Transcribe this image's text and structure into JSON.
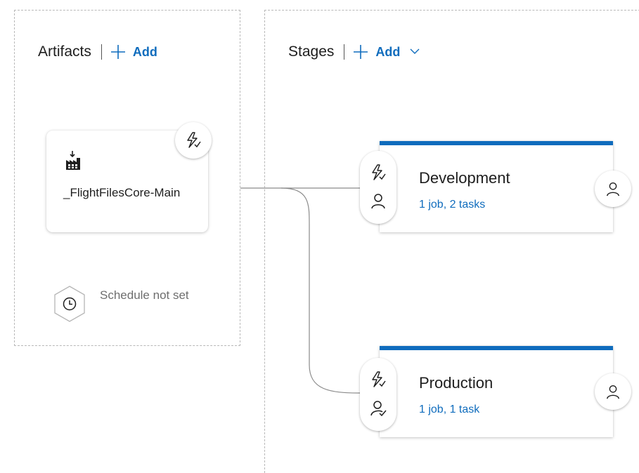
{
  "artifacts": {
    "title": "Artifacts",
    "add_label": "Add",
    "items": [
      {
        "name": "_FlightFilesCore-Main",
        "icon": "build-artifact-icon"
      }
    ],
    "trigger_icon": "continuous-deployment-trigger-icon",
    "schedule": {
      "label": "Schedule not set",
      "icon": "clock-icon"
    }
  },
  "stages": {
    "title": "Stages",
    "add_label": "Add",
    "items": [
      {
        "name": "Development",
        "detail": "1 job, 2 tasks",
        "pre_icons": [
          "trigger-icon",
          "pre-deployment-approver-icon"
        ],
        "post_icon": "post-deployment-approver-icon"
      },
      {
        "name": "Production",
        "detail": "1 job, 1 task",
        "pre_icons": [
          "trigger-icon",
          "pre-deployment-approval-check-icon"
        ],
        "post_icon": "post-deployment-approver-icon"
      }
    ]
  },
  "colors": {
    "accent": "#0f6cbd",
    "text": "#1e1e1e",
    "muted_text": "#6e6e6e",
    "connector": "#8a8a8a",
    "panel_border": "#b8b8b8"
  }
}
